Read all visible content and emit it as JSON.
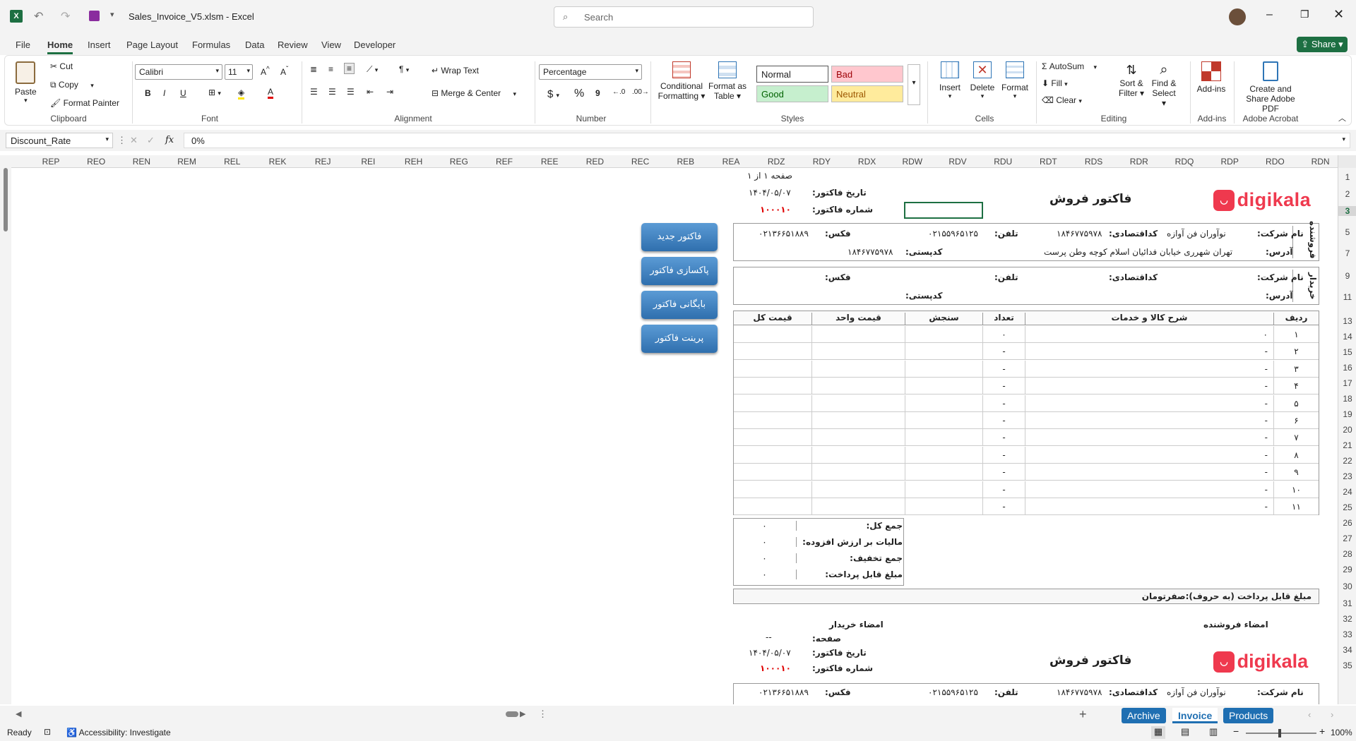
{
  "titlebar": {
    "filename": "Sales_Invoice_V5.xlsm",
    "app": "-  Excel",
    "search_placeholder": "Search"
  },
  "menu": {
    "tabs": [
      "File",
      "Home",
      "Insert",
      "Page Layout",
      "Formulas",
      "Data",
      "Review",
      "View",
      "Developer"
    ],
    "share": "Share"
  },
  "ribbon": {
    "clipboard": {
      "paste": "Paste",
      "cut": "Cut",
      "copy": "Copy",
      "painter": "Format Painter",
      "label": "Clipboard"
    },
    "font": {
      "name": "Calibri",
      "size": "11",
      "label": "Font",
      "bold": "B",
      "italic": "I",
      "underline": "U"
    },
    "alignment": {
      "wrap": "Wrap Text",
      "merge": "Merge & Center",
      "label": "Alignment"
    },
    "number": {
      "format": "Percentage",
      "currency": "$",
      "percent": "%",
      "comma": "9",
      "label": "Number"
    },
    "styles": {
      "cond": "Conditional Formatting",
      "table": "Format as Table",
      "normal": "Normal",
      "bad": "Bad",
      "good": "Good",
      "neutral": "Neutral",
      "label": "Styles"
    },
    "cells": {
      "insert": "Insert",
      "delete": "Delete",
      "format": "Format",
      "label": "Cells"
    },
    "editing": {
      "autosum": "AutoSum",
      "fill": "Fill",
      "clear": "Clear",
      "sort": "Sort & Filter",
      "find": "Find & Select",
      "label": "Editing"
    },
    "addins": {
      "addins": "Add-ins",
      "label": "Add-ins"
    },
    "acrobat": {
      "create": "Create and Share Adobe PDF",
      "label": "Adobe Acrobat"
    }
  },
  "formula_bar": {
    "name_box": "Discount_Rate",
    "fx": "fx",
    "value": "0%"
  },
  "columns": [
    "REP",
    "REO",
    "REN",
    "REM",
    "REL",
    "REK",
    "REJ",
    "REI",
    "REH",
    "REG",
    "REF",
    "REE",
    "RED",
    "REC",
    "REB",
    "REA",
    "RDZ",
    "RDY",
    "RDX",
    "RDW",
    "RDV",
    "RDU",
    "RDT",
    "RDS",
    "RDR",
    "RDQ",
    "RDP",
    "RDO",
    "RDN"
  ],
  "rows": [
    "1",
    "2",
    "3",
    "5",
    "7",
    "9",
    "11",
    "13",
    "14",
    "15",
    "16",
    "17",
    "18",
    "19",
    "20",
    "21",
    "22",
    "23",
    "24",
    "25",
    "26",
    "27",
    "28",
    "29",
    "30",
    "31",
    "32",
    "33",
    "34",
    "35"
  ],
  "macro_buttons": [
    "فاکتور جدید",
    "پاکسازی فاکتور",
    "بایگانی فاکتور",
    "پرینت فاکتور"
  ],
  "invoice": {
    "logo": "digikala",
    "title": "فاکتور فروش",
    "page": "صفحه ۱ از ۱",
    "date_label": "تاریخ فاکتور:",
    "date": "۱۴۰۴/۰۵/۰۷",
    "no_label": "شماره فاکتور:",
    "no": "۱۰۰۰۱۰",
    "seller_side": "فروشنده",
    "buyer_side": "خریدار",
    "company_label": "نام شرکت:",
    "company": "نوآوران فن آوازه",
    "econ_label": "کداقتصادی:",
    "econ": "۱۸۴۶۷۷۵۹۷۸",
    "tel_label": "تلفن:",
    "tel": "۰۲۱۵۵۹۶۵۱۲۵",
    "fax_label": "فکس:",
    "fax": "۰۲۱۳۶۶۵۱۸۸۹",
    "addr_label": "آدرس:",
    "addr": "تهران شهرری خیابان فدائیان اسلام کوچه وطن پرست",
    "postal_label": "کدپستی:",
    "postal": "۱۸۴۶۷۷۵۹۷۸",
    "headers": [
      "ردیف",
      "شرح کالا و خدمات",
      "تعداد",
      "سنجش",
      "قیمت واحد",
      "قیمت کل"
    ],
    "row_nums": [
      "۱",
      "۲",
      "۳",
      "۴",
      "۵",
      "۶",
      "۷",
      "۸",
      "۹",
      "۱۰",
      "۱۱"
    ],
    "totals": [
      {
        "label": "جمع کل:",
        "value": "۰"
      },
      {
        "label": "مالیات بر ارزش افزوده:",
        "value": "۰"
      },
      {
        "label": "جمع تخفیف:",
        "value": "۰"
      },
      {
        "label": "مبلغ قابل پرداخت:",
        "value": "۰"
      }
    ],
    "words": "مبلغ قابل پرداخت (به حروف):صفرتومان",
    "sign_seller": "امضاء فروشنده",
    "sign_buyer": "امضاء خریدار",
    "page2_label": "صفحه:",
    "page2": "--"
  },
  "sheets": {
    "archive": "Archive",
    "invoice": "Invoice",
    "products": "Products"
  },
  "status": {
    "ready": "Ready",
    "access": "Accessibility: Investigate",
    "zoom": "100%"
  }
}
